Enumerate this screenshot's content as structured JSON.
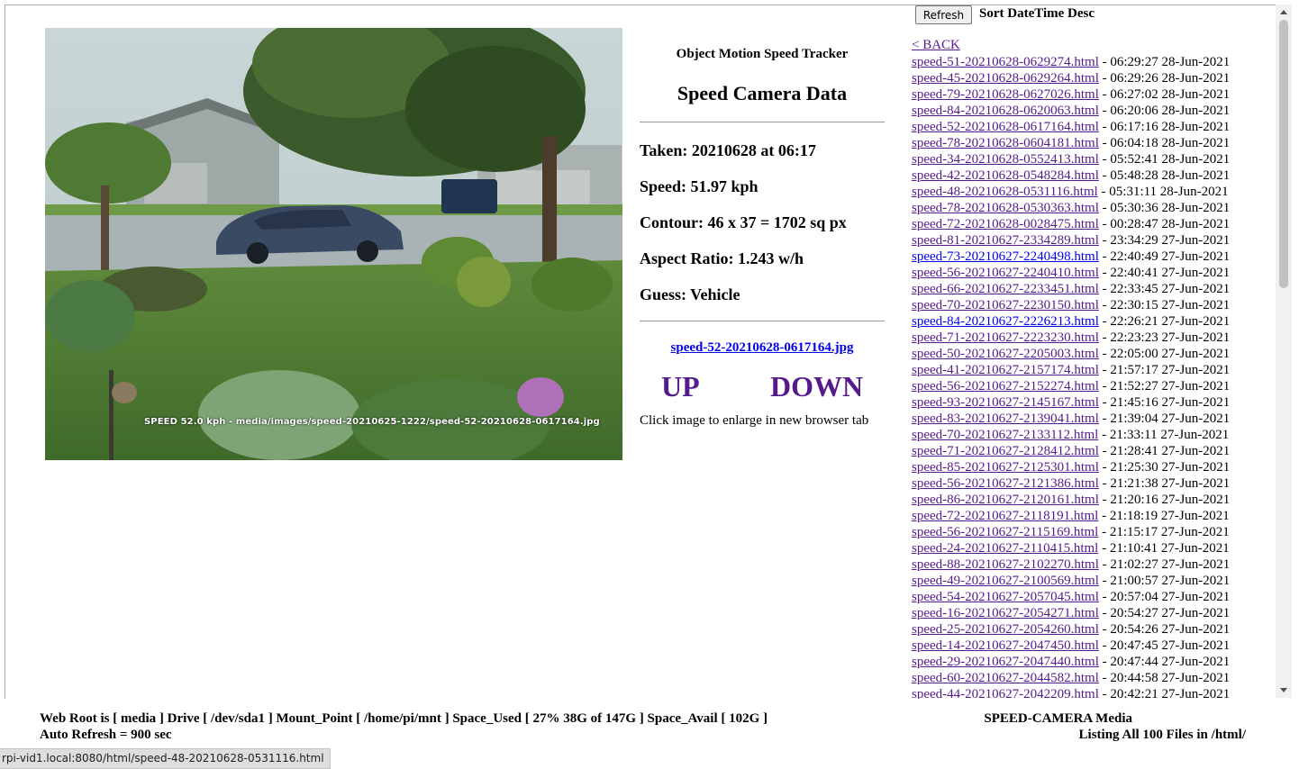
{
  "main": {
    "image_overlay_text": "SPEED 52.0 kph - media/images/speed-20210625-1222/speed-52-20210628-0617164.jpg",
    "app_title": "Object Motion Speed Tracker",
    "heading": "Speed Camera Data",
    "taken": "Taken: 20210628 at 06:17",
    "speed": "Speed: 51.97 kph",
    "contour": "Contour: 46 x 37 = 1702 sq px",
    "aspect": "Aspect Ratio: 1.243 w/h",
    "guess": "Guess: Vehicle",
    "image_link": "speed-52-20210628-0617164.jpg",
    "up_label": "UP",
    "down_label": "DOWN",
    "hint": "Click image to enlarge in new browser tab"
  },
  "sidebar": {
    "refresh_label": "Refresh",
    "sort_label": "Sort DateTime Desc",
    "back_label": "< BACK",
    "files": [
      {
        "name": "speed-51-20210628-0629274.html",
        "time": "06:29:27 28-Jun-2021",
        "visited": true
      },
      {
        "name": "speed-45-20210628-0629264.html",
        "time": "06:29:26 28-Jun-2021",
        "visited": true
      },
      {
        "name": "speed-79-20210628-0627026.html",
        "time": "06:27:02 28-Jun-2021",
        "visited": true
      },
      {
        "name": "speed-84-20210628-0620063.html",
        "time": "06:20:06 28-Jun-2021",
        "visited": true
      },
      {
        "name": "speed-52-20210628-0617164.html",
        "time": "06:17:16 28-Jun-2021",
        "visited": true
      },
      {
        "name": "speed-78-20210628-0604181.html",
        "time": "06:04:18 28-Jun-2021",
        "visited": true
      },
      {
        "name": "speed-34-20210628-0552413.html",
        "time": "05:52:41 28-Jun-2021",
        "visited": true
      },
      {
        "name": "speed-42-20210628-0548284.html",
        "time": "05:48:28 28-Jun-2021",
        "visited": true
      },
      {
        "name": "speed-48-20210628-0531116.html",
        "time": "05:31:11 28-Jun-2021",
        "visited": true
      },
      {
        "name": "speed-78-20210628-0530363.html",
        "time": "05:30:36 28-Jun-2021",
        "visited": true
      },
      {
        "name": "speed-72-20210628-0028475.html",
        "time": "00:28:47 28-Jun-2021",
        "visited": true
      },
      {
        "name": "speed-81-20210627-2334289.html",
        "time": "23:34:29 27-Jun-2021",
        "visited": true
      },
      {
        "name": "speed-73-20210627-2240498.html",
        "time": "22:40:49 27-Jun-2021",
        "visited": false
      },
      {
        "name": "speed-56-20210627-2240410.html",
        "time": "22:40:41 27-Jun-2021",
        "visited": true
      },
      {
        "name": "speed-66-20210627-2233451.html",
        "time": "22:33:45 27-Jun-2021",
        "visited": true
      },
      {
        "name": "speed-70-20210627-2230150.html",
        "time": "22:30:15 27-Jun-2021",
        "visited": true
      },
      {
        "name": "speed-84-20210627-2226213.html",
        "time": "22:26:21 27-Jun-2021",
        "visited": false
      },
      {
        "name": "speed-71-20210627-2223230.html",
        "time": "22:23:23 27-Jun-2021",
        "visited": true
      },
      {
        "name": "speed-50-20210627-2205003.html",
        "time": "22:05:00 27-Jun-2021",
        "visited": true
      },
      {
        "name": "speed-41-20210627-2157174.html",
        "time": "21:57:17 27-Jun-2021",
        "visited": true
      },
      {
        "name": "speed-56-20210627-2152274.html",
        "time": "21:52:27 27-Jun-2021",
        "visited": true
      },
      {
        "name": "speed-93-20210627-2145167.html",
        "time": "21:45:16 27-Jun-2021",
        "visited": true
      },
      {
        "name": "speed-83-20210627-2139041.html",
        "time": "21:39:04 27-Jun-2021",
        "visited": true
      },
      {
        "name": "speed-70-20210627-2133112.html",
        "time": "21:33:11 27-Jun-2021",
        "visited": true
      },
      {
        "name": "speed-71-20210627-2128412.html",
        "time": "21:28:41 27-Jun-2021",
        "visited": true
      },
      {
        "name": "speed-85-20210627-2125301.html",
        "time": "21:25:30 27-Jun-2021",
        "visited": true
      },
      {
        "name": "speed-56-20210627-2121386.html",
        "time": "21:21:38 27-Jun-2021",
        "visited": true
      },
      {
        "name": "speed-86-20210627-2120161.html",
        "time": "21:20:16 27-Jun-2021",
        "visited": true
      },
      {
        "name": "speed-72-20210627-2118191.html",
        "time": "21:18:19 27-Jun-2021",
        "visited": true
      },
      {
        "name": "speed-56-20210627-2115169.html",
        "time": "21:15:17 27-Jun-2021",
        "visited": true
      },
      {
        "name": "speed-24-20210627-2110415.html",
        "time": "21:10:41 27-Jun-2021",
        "visited": true
      },
      {
        "name": "speed-88-20210627-2102270.html",
        "time": "21:02:27 27-Jun-2021",
        "visited": true
      },
      {
        "name": "speed-49-20210627-2100569.html",
        "time": "21:00:57 27-Jun-2021",
        "visited": true
      },
      {
        "name": "speed-54-20210627-2057045.html",
        "time": "20:57:04 27-Jun-2021",
        "visited": true
      },
      {
        "name": "speed-16-20210627-2054271.html",
        "time": "20:54:27 27-Jun-2021",
        "visited": true
      },
      {
        "name": "speed-25-20210627-2054260.html",
        "time": "20:54:26 27-Jun-2021",
        "visited": true
      },
      {
        "name": "speed-14-20210627-2047450.html",
        "time": "20:47:45 27-Jun-2021",
        "visited": true
      },
      {
        "name": "speed-29-20210627-2047440.html",
        "time": "20:47:44 27-Jun-2021",
        "visited": true
      },
      {
        "name": "speed-60-20210627-2044582.html",
        "time": "20:44:58 27-Jun-2021",
        "visited": true
      },
      {
        "name": "speed-44-20210627-2042209.html",
        "time": "20:42:21 27-Jun-2021",
        "visited": true
      }
    ]
  },
  "footer": {
    "storage_info": "Web Root is [ media ] Drive [ /dev/sda1 ] Mount_Point [ /home/pi/mnt ] Space_Used [ 27% 38G of 147G ] Space_Avail [ 102G ]",
    "auto_refresh": "Auto Refresh = 900 sec",
    "media_title": "SPEED-CAMERA Media",
    "listing_summary": "Listing All 100 Files in /html/"
  },
  "status_bar": {
    "url": "rpi-vid1.local:8080/html/speed-48-20210628-0531116.html"
  },
  "colors": {
    "link_visited": "#551a8b",
    "link_unvisited": "#0000ee"
  }
}
